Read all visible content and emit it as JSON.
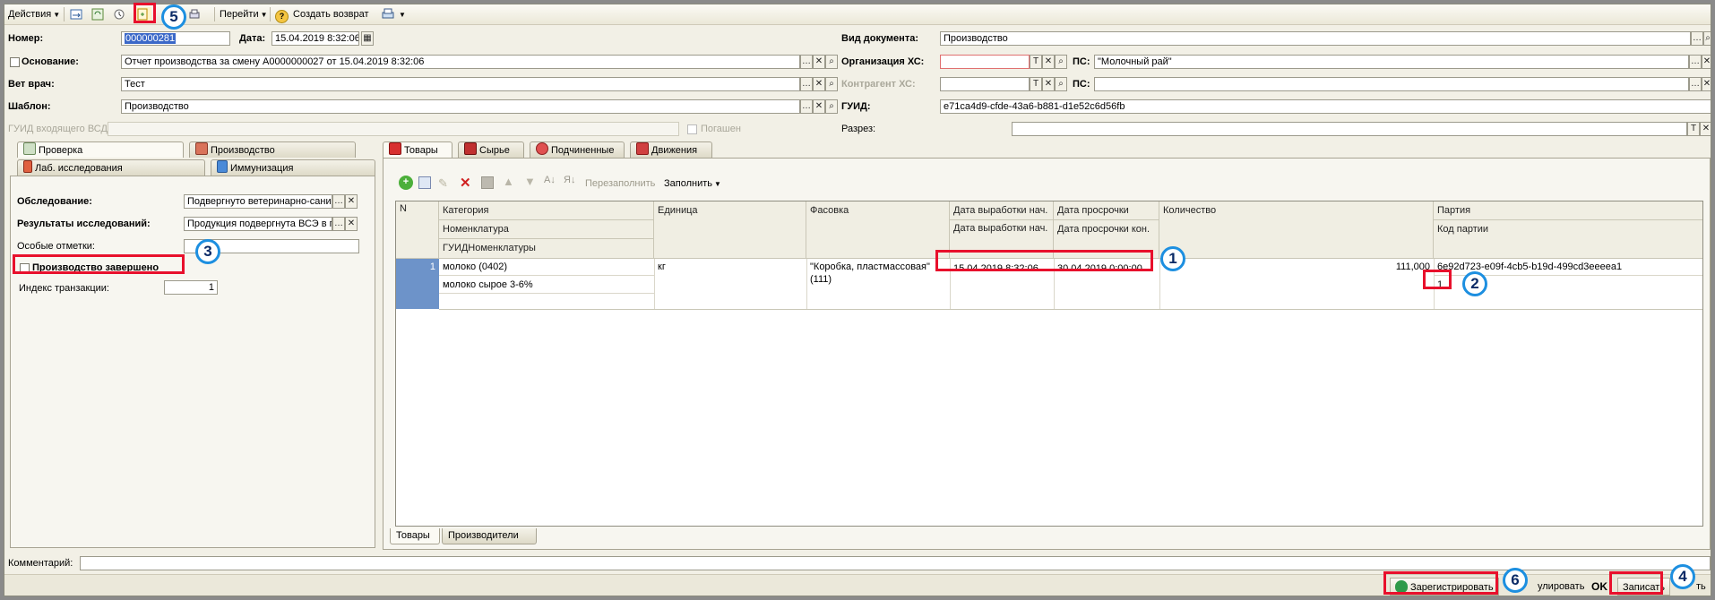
{
  "toolbar": {
    "actions": "Действия",
    "goto": "Перейти",
    "create_return": "Создать возврат"
  },
  "header": {
    "number_label": "Номер:",
    "number_value": "000000281",
    "date_label": "Дата:",
    "date_value": "15.04.2019 8:32:06",
    "basis_label": "Основание:",
    "basis_value": "Отчет производства за смену А0000000027 от 15.04.2019 8:32:06",
    "vet_label": "Вет врач:",
    "vet_value": "Тест",
    "template_label": "Шаблон:",
    "template_value": "Производство",
    "guid_in_label": "ГУИД входящего ВСД:",
    "cancelled_label": "Погашен",
    "doc_type_label": "Вид документа:",
    "doc_type_value": "Производство",
    "org_label": "Организация ХС:",
    "org_ps_label": "ПС:",
    "org_ps_value": "\"Молочный рай\"",
    "contractor_label": "Контрагент ХС:",
    "contractor_ps_label": "ПС:",
    "guid_label": "ГУИД:",
    "guid_value": "e71ca4d9-cfde-43a6-b881-d1e52c6d56fb",
    "section_label": "Разрез:"
  },
  "left_tabs": [
    "Проверка",
    "Производство",
    "Лаб. исследования",
    "Иммунизация"
  ],
  "left_panel": {
    "exam_label": "Обследование:",
    "exam_value": "Подвергнуто ветеринарно-сани",
    "results_label": "Результаты исследований:",
    "results_value": "Продукция подвергнута ВСЭ в г",
    "notes_label": "Особые отметки:",
    "finished_label": "Производство завершено",
    "tx_index_label": "Индекс транзакции:",
    "tx_index_value": "1"
  },
  "right_tabs": [
    "Товары",
    "Сырье",
    "Подчиненные",
    "Движения"
  ],
  "grid_toolbar": {
    "refill": "Перезаполнить",
    "fill": "Заполнить"
  },
  "grid": {
    "headers": {
      "n": "N",
      "category": "Категория",
      "nomenclature": "Номенклатура",
      "guid_nom": "ГУИДНоменклатуры",
      "unit": "Единица",
      "packaging": "Фасовка",
      "prod_date": "Дата выработки нач.",
      "prod_date2": "Дата выработки нач.",
      "expiry": "Дата просрочки",
      "expiry2": "Дата просрочки кон.",
      "qty": "Количество",
      "batch": "Партия",
      "batch_code": "Код партии"
    },
    "row": {
      "n": "1",
      "category": "молоко (0402)",
      "nomenclature": "молоко сырое 3-6%",
      "unit": "кг",
      "packaging": "\"Коробка, пластмассовая\"(111)",
      "prod_date": "15.04.2019 8:32:06",
      "expiry": "30.04.2019 0:00:00",
      "qty": "111,000",
      "batch": "6e92d723-e09f-4cb5-b19d-499cd3eeeea1",
      "batch_code": "1"
    }
  },
  "bottom_tabs": [
    "Товары",
    "Производители"
  ],
  "comment_label": "Комментарий:",
  "bottom_bar": {
    "register": "Зарегистрировать",
    "annul": "улировать",
    "ok": "OK",
    "save": "Записать",
    "close_tail": "ть"
  },
  "callouts": [
    "1",
    "2",
    "3",
    "4",
    "5",
    "6"
  ],
  "colors": {
    "highlight": "#e8102c",
    "callout_ring": "#1d8fe0"
  }
}
